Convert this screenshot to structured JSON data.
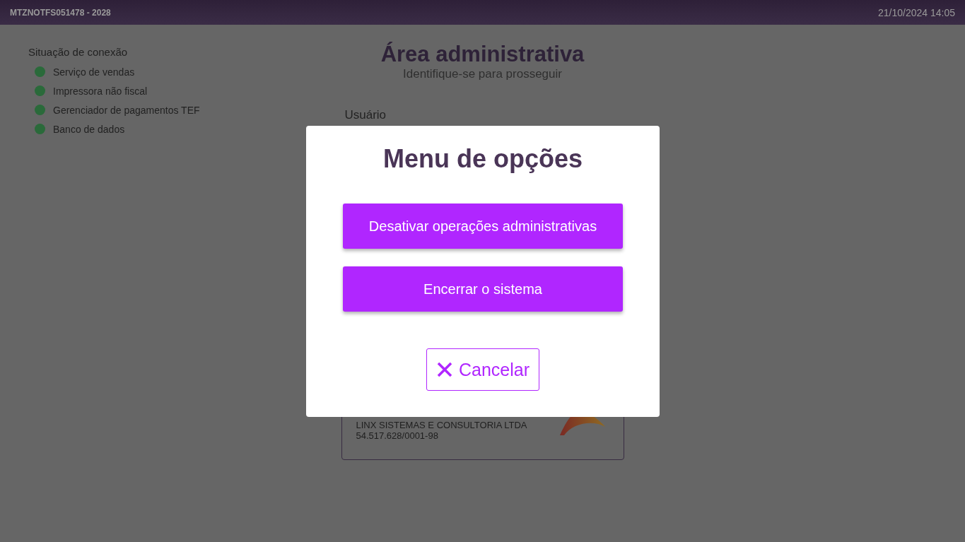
{
  "header": {
    "terminal": "MTZNOTFS051478 - 2028",
    "datetime": "21/10/2024 14:05"
  },
  "connection_status": {
    "title": "Situação de conexão",
    "items": [
      {
        "label": "Serviço de vendas",
        "color": "#2a6a3a"
      },
      {
        "label": "Impressora não fiscal",
        "color": "#2a6a3a"
      },
      {
        "label": "Gerenciador de pagamentos TEF",
        "color": "#2a6a3a"
      },
      {
        "label": "Banco de dados",
        "color": "#2a6a3a"
      }
    ]
  },
  "admin": {
    "title": "Área administrativa",
    "subtitle": "Identifique-se para prosseguir",
    "user_label": "Usuário"
  },
  "company_card": {
    "name": "LINX SISTEMAS E CONSULTORIA LTDA",
    "cnpj": "54.517.628/0001-98"
  },
  "modal": {
    "title": "Menu de opções",
    "options": [
      "Desativar operações administrativas",
      "Encerrar o sistema"
    ],
    "cancel": "Cancelar"
  }
}
